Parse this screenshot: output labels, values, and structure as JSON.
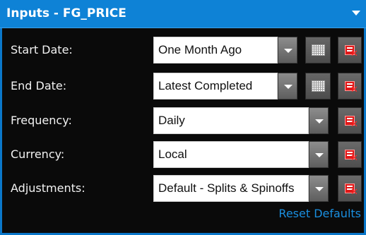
{
  "panel": {
    "title": "Inputs - FG_PRICE",
    "collapse_icon": "chevron-down-icon"
  },
  "rows": [
    {
      "label": "Start Date:",
      "value": "One Month Ago",
      "has_calendar": true
    },
    {
      "label": "End Date:",
      "value": "Latest Completed",
      "has_calendar": true
    },
    {
      "label": "Frequency:",
      "value": "Daily",
      "has_calendar": false
    },
    {
      "label": "Currency:",
      "value": "Local",
      "has_calendar": false
    },
    {
      "label": "Adjustments:",
      "value": "Default - Splits & Spinoffs",
      "has_calendar": false
    }
  ],
  "icons": {
    "dropdown": "dropdown-arrow-icon",
    "calendar": "calendar-icon",
    "clear": "clear-field-icon"
  },
  "footer": {
    "reset_label": "Reset Defaults"
  },
  "colors": {
    "title_bar": "#0e82d6",
    "panel_bg": "#0a0a0a",
    "link": "#1a8fe0",
    "clear_icon": "#e01818"
  }
}
